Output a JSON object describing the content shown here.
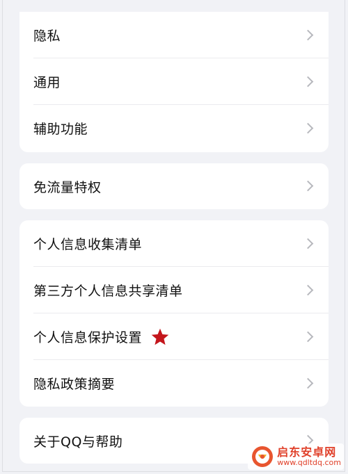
{
  "settings": {
    "group1": [
      {
        "label": "隐私"
      },
      {
        "label": "通用"
      },
      {
        "label": "辅助功能"
      }
    ],
    "group2": [
      {
        "label": "免流量特权"
      }
    ],
    "group3": [
      {
        "label": "个人信息收集清单"
      },
      {
        "label": "第三方个人信息共享清单"
      },
      {
        "label": "个人信息保护设置",
        "marker_color": "#c4161c"
      },
      {
        "label": "隐私政策摘要"
      }
    ],
    "group4": [
      {
        "label": "关于QQ与帮助"
      }
    ]
  },
  "watermark": {
    "title": "启东安卓网",
    "url": "www.qdltdq.com"
  },
  "icons": {
    "chevron": "chevron-right-icon",
    "star": "star-icon"
  }
}
